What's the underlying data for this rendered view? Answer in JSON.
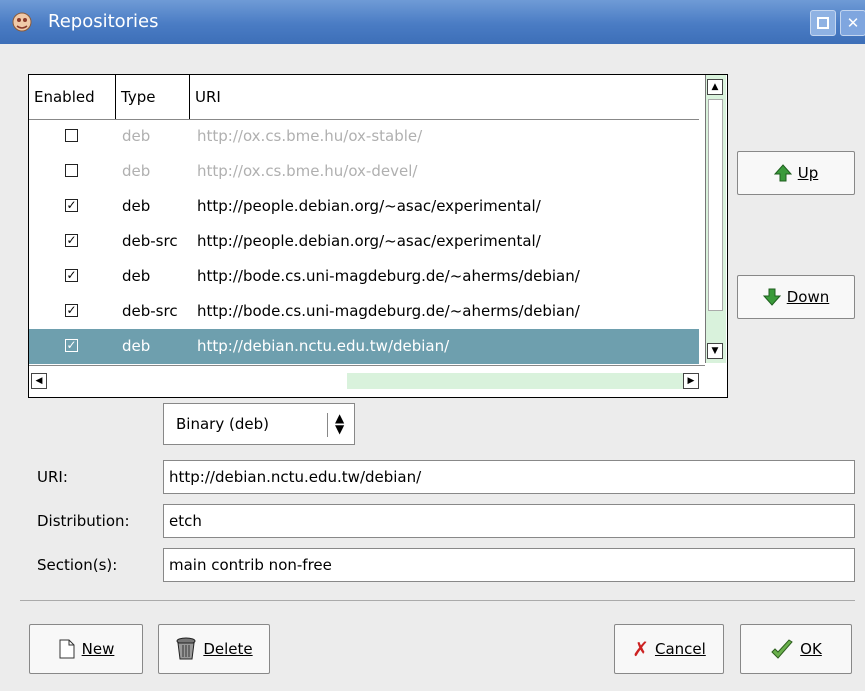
{
  "window": {
    "title": "Repositories",
    "maximize_icon": "maximize-icon",
    "close_label": "✕"
  },
  "list": {
    "columns": [
      "Enabled",
      "Type",
      "URI"
    ],
    "rows": [
      {
        "enabled": false,
        "type": "deb",
        "uri": "http://ox.cs.bme.hu/ox-stable/"
      },
      {
        "enabled": false,
        "type": "deb",
        "uri": "http://ox.cs.bme.hu/ox-devel/"
      },
      {
        "enabled": true,
        "type": "deb",
        "uri": "http://people.debian.org/~asac/experimental/"
      },
      {
        "enabled": true,
        "type": "deb-src",
        "uri": "http://people.debian.org/~asac/experimental/"
      },
      {
        "enabled": true,
        "type": "deb",
        "uri": "http://bode.cs.uni-magdeburg.de/~aherms/debian/"
      },
      {
        "enabled": true,
        "type": "deb-src",
        "uri": "http://bode.cs.uni-magdeburg.de/~aherms/debian/"
      },
      {
        "enabled": true,
        "type": "deb",
        "uri": "http://debian.nctu.edu.tw/debian/",
        "selected": true
      }
    ]
  },
  "buttons": {
    "up": "Up",
    "down": "Down",
    "new": "New",
    "delete": "Delete",
    "cancel": "Cancel",
    "ok": "OK"
  },
  "form": {
    "type_value": "Binary (deb)",
    "uri_label": "URI:",
    "uri_value": "http://debian.nctu.edu.tw/debian/",
    "distribution_label": "Distribution:",
    "distribution_value": "etch",
    "sections_label": "Section(s):",
    "sections_value": "main contrib non-free"
  },
  "colors": {
    "title_bar": "#4a7cc4",
    "selection": "#6e9fae",
    "scroll_track": "#d9f2dc"
  }
}
